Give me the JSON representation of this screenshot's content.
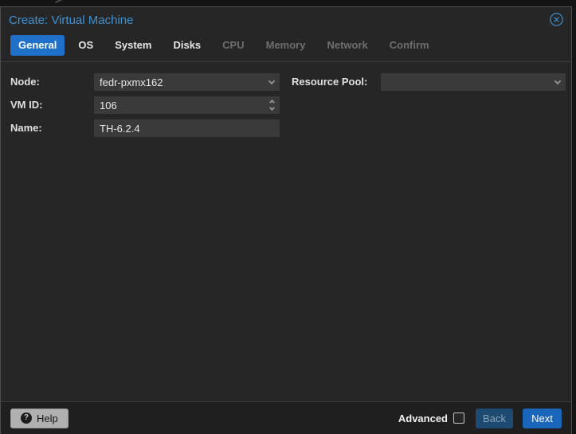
{
  "dialog": {
    "title": "Create: Virtual Machine"
  },
  "tabs": [
    {
      "label": "General",
      "state": "active"
    },
    {
      "label": "OS",
      "state": "enabled"
    },
    {
      "label": "System",
      "state": "enabled"
    },
    {
      "label": "Disks",
      "state": "enabled"
    },
    {
      "label": "CPU",
      "state": "disabled"
    },
    {
      "label": "Memory",
      "state": "disabled"
    },
    {
      "label": "Network",
      "state": "disabled"
    },
    {
      "label": "Confirm",
      "state": "disabled"
    }
  ],
  "form": {
    "node": {
      "label": "Node:",
      "value": "fedr-pxmx162",
      "control": "combobox"
    },
    "vmid": {
      "label": "VM ID:",
      "value": "106",
      "control": "spinner"
    },
    "name": {
      "label": "Name:",
      "value": "TH-6.2.4",
      "control": "text"
    },
    "resource_pool": {
      "label": "Resource Pool:",
      "value": "",
      "control": "combobox"
    }
  },
  "footer": {
    "help_label": "Help",
    "advanced_label": "Advanced",
    "advanced_checked": false,
    "back_label": "Back",
    "next_label": "Next"
  },
  "icons": {
    "help_glyph": "?",
    "close": "circle-x"
  },
  "colors": {
    "accent_blue": "#1a66bb",
    "active_tab_blue": "#1e70c8",
    "title_blue": "#3d92d5",
    "dialog_bg": "#262626",
    "input_bg": "#3a3a3a",
    "footer_bg": "#1f1f1f",
    "back_btn_bg": "#1c4a72",
    "help_btn_bg": "#b0b0b0"
  }
}
